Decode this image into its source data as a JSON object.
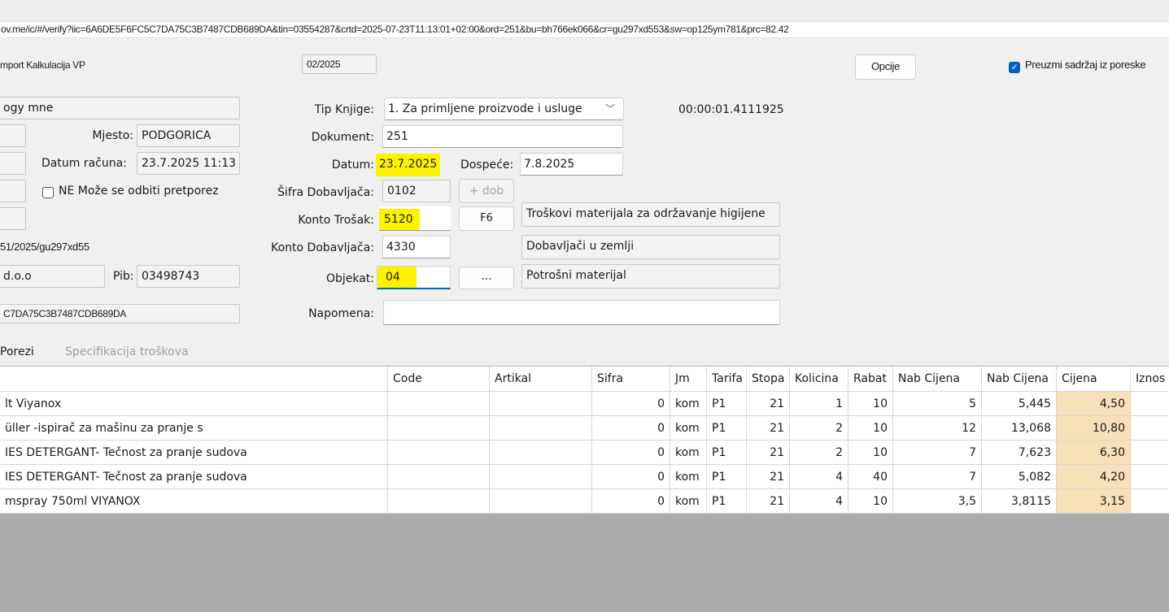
{
  "url": "ov.me/ic/#/verify?iic=6A6DE5F6FC5C7DA75C3B7487CDB689DA&tin=03554287&crtd=2025-07-23T11:13:01+02:00&ord=251&bu=bh766ek066&cr=gu297xd553&sw=op125ym781&prc=82.42",
  "left": {
    "import_label": "mport Kalkulacija VP",
    "supplier_name": "ogy mne",
    "mjesto_label": "Mjesto:",
    "mjesto_value": "PODGORICA",
    "datum_racuna_label": "Datum računa:",
    "datum_racuna_value": "23.7.2025 11:13",
    "ne_moze_label": "NE Može se odbiti pretporez",
    "ref_value": "51/2025/gu297xd55",
    "company_value": "d.o.o",
    "pib_label": "Pib:",
    "pib_value": "03498743",
    "iic_value": "C7DA75C3B7487CDB689DA"
  },
  "middle": {
    "period_value": "02/2025",
    "tip_knjige_label": "Tip Knjige:",
    "tip_knjige_value": "1. Za primljene proizvode i usluge",
    "timer": "00:00:01.4111925",
    "dokument_label": "Dokument:",
    "dokument_value": "251",
    "datum_label": "Datum:",
    "datum_value": "23.7.2025",
    "dospece_label": "Dospeće:",
    "dospece_value": "7.8.2025",
    "sifra_dob_label": "Šifra Dobavljača:",
    "sifra_dob_value": "0102",
    "add_dob_label": "+ dob",
    "konto_trosak_label": "Konto Trošak:",
    "konto_trosak_value": "5120",
    "f6_label": "F6",
    "konto_trosak_desc": "Troškovi materijala za održavanje higijene",
    "konto_dob_label": "Konto Dobavljača:",
    "konto_dob_value": "4330",
    "konto_dob_desc": "Dobavljači u zemlji",
    "objekat_label": "Objekat:",
    "objekat_value": "04",
    "objekat_btn": "...",
    "objekat_desc": "Potrošni materijal",
    "napomena_label": "Napomena:",
    "napomena_value": ""
  },
  "right": {
    "opcije_label": "Opcije",
    "preuzmi_label": "Preuzmi sadržaj iz poreske"
  },
  "tabs": [
    {
      "label": "Porezi"
    },
    {
      "label": "Specifikacija troškova"
    }
  ],
  "table": {
    "columns": [
      "",
      "Code",
      "Artikal",
      "Sifra",
      "Jm",
      "Tarifa",
      "Stopa",
      "Kolicina",
      "Rabat",
      "Nab Cijena",
      "Nab Cijena",
      "Cijena",
      "Iznos"
    ],
    "rows": [
      [
        "lt Viyanox",
        "",
        "",
        "0",
        "kom",
        "P1",
        "21",
        "1",
        "10",
        "5",
        "5,445",
        "4,50",
        ""
      ],
      [
        "üller -ispirač za mašinu za pranje s",
        "",
        "",
        "0",
        "kom",
        "P1",
        "21",
        "2",
        "10",
        "12",
        "13,068",
        "10,80",
        ""
      ],
      [
        "IES DETERGANT- Tečnost za pranje sudova",
        "",
        "",
        "0",
        "kom",
        "P1",
        "21",
        "2",
        "10",
        "7",
        "7,623",
        "6,30",
        ""
      ],
      [
        "IES DETERGANT- Tečnost za pranje sudova",
        "",
        "",
        "0",
        "kom",
        "P1",
        "21",
        "4",
        "40",
        "7",
        "5,082",
        "4,20",
        ""
      ],
      [
        "mspray 750ml VIYANOX",
        "",
        "",
        "0",
        "kom",
        "P1",
        "21",
        "4",
        "10",
        "3,5",
        "3,8115",
        "3,15",
        ""
      ]
    ]
  },
  "colors": {
    "highlight": "#fff200",
    "cijena_cell": "#f8dfb8",
    "accent": "#005fb8"
  }
}
